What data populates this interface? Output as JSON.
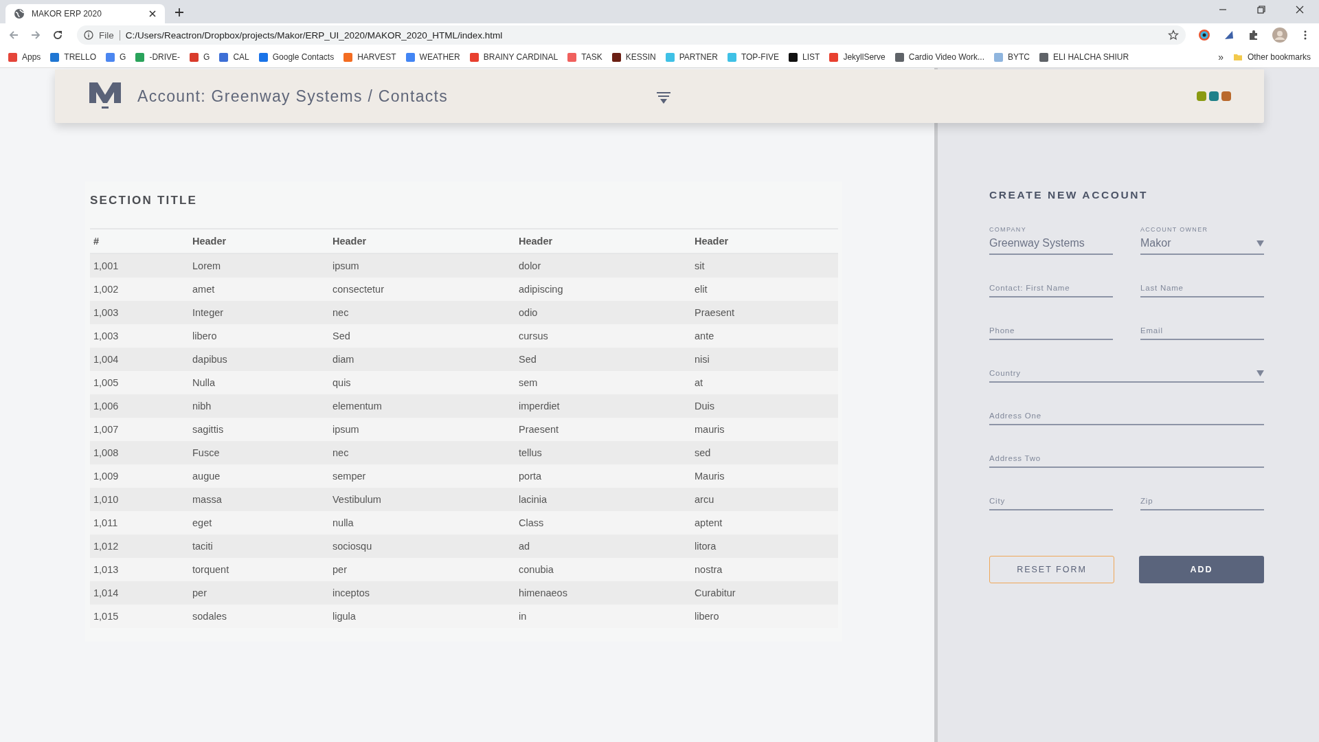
{
  "browser": {
    "tab": {
      "title": "MAKOR ERP 2020"
    },
    "address": {
      "scheme": "File",
      "url": "C:/Users/Reactron/Dropbox/projects/Makor/ERP_UI_2020/MAKOR_2020_HTML/index.html"
    },
    "bookmarks": [
      {
        "label": "Apps",
        "color": "#e5453a"
      },
      {
        "label": "TRELLO",
        "color": "#1f76d3"
      },
      {
        "label": "G",
        "color": "#4b86f0"
      },
      {
        "label": "-DRIVE-",
        "color": "#2aa35b"
      },
      {
        "label": "G",
        "color": "#d93b2b"
      },
      {
        "label": "CAL",
        "color": "#3d6fd6"
      },
      {
        "label": "Google Contacts",
        "color": "#1a73e8"
      },
      {
        "label": "HARVEST",
        "color": "#f36c21"
      },
      {
        "label": "WEATHER",
        "color": "#4285f4"
      },
      {
        "label": "BRAINY CARDINAL",
        "color": "#e8402f"
      },
      {
        "label": "TASK",
        "color": "#f0605d"
      },
      {
        "label": "KESSIN",
        "color": "#6b1f14"
      },
      {
        "label": "PARTNER",
        "color": "#3fc1e6"
      },
      {
        "label": "TOP-FIVE",
        "color": "#3fc1e6"
      },
      {
        "label": "LIST",
        "color": "#111111"
      },
      {
        "label": "JekyllServe",
        "color": "#e8402f"
      },
      {
        "label": "Cardio Video Work...",
        "color": "#5f6368"
      },
      {
        "label": "BYTC",
        "color": "#8fb5de"
      },
      {
        "label": "ELI HALCHA SHIUR",
        "color": "#5f6368"
      }
    ],
    "more": "»",
    "other_bookmarks": "Other bookmarks"
  },
  "header": {
    "title": "Account: Greenway Systems / Contacts",
    "dots": [
      {
        "color": "#8a9a12"
      },
      {
        "color": "#1f8089"
      },
      {
        "color": "#b9692c"
      }
    ]
  },
  "table": {
    "title": "SECTION TITLE",
    "columns": [
      "#",
      "Header",
      "Header",
      "Header",
      "Header"
    ],
    "rows": [
      [
        "1,001",
        "Lorem",
        "ipsum",
        "dolor",
        "sit"
      ],
      [
        "1,002",
        "amet",
        "consectetur",
        "adipiscing",
        "elit"
      ],
      [
        "1,003",
        "Integer",
        "nec",
        "odio",
        "Praesent"
      ],
      [
        "1,003",
        "libero",
        "Sed",
        "cursus",
        "ante"
      ],
      [
        "1,004",
        "dapibus",
        "diam",
        "Sed",
        "nisi"
      ],
      [
        "1,005",
        "Nulla",
        "quis",
        "sem",
        "at"
      ],
      [
        "1,006",
        "nibh",
        "elementum",
        "imperdiet",
        "Duis"
      ],
      [
        "1,007",
        "sagittis",
        "ipsum",
        "Praesent",
        "mauris"
      ],
      [
        "1,008",
        "Fusce",
        "nec",
        "tellus",
        "sed"
      ],
      [
        "1,009",
        "augue",
        "semper",
        "porta",
        "Mauris"
      ],
      [
        "1,010",
        "massa",
        "Vestibulum",
        "lacinia",
        "arcu"
      ],
      [
        "1,011",
        "eget",
        "nulla",
        "Class",
        "aptent"
      ],
      [
        "1,012",
        "taciti",
        "sociosqu",
        "ad",
        "litora"
      ],
      [
        "1,013",
        "torquent",
        "per",
        "conubia",
        "nostra"
      ],
      [
        "1,014",
        "per",
        "inceptos",
        "himenaeos",
        "Curabitur"
      ],
      [
        "1,015",
        "sodales",
        "ligula",
        "in",
        "libero"
      ]
    ]
  },
  "form": {
    "title": "CREATE NEW ACCOUNT",
    "rows": [
      [
        {
          "kind": "text",
          "label": "COMPANY",
          "value": "Greenway Systems"
        },
        {
          "kind": "select",
          "label": "ACCOUNT OWNER",
          "value": "Makor"
        }
      ],
      [
        {
          "kind": "text",
          "placeholder": "Contact: First Name"
        },
        {
          "kind": "text",
          "placeholder": "Last Name"
        }
      ],
      [
        {
          "kind": "text",
          "placeholder": "Phone"
        },
        {
          "kind": "text",
          "placeholder": "Email"
        }
      ],
      [
        {
          "kind": "select",
          "placeholder": "Country"
        }
      ],
      [
        {
          "kind": "text",
          "placeholder": "Address One"
        }
      ],
      [
        {
          "kind": "text",
          "placeholder": "Address Two"
        }
      ],
      [
        {
          "kind": "text",
          "placeholder": "City"
        },
        {
          "kind": "text",
          "placeholder": "Zip"
        }
      ]
    ],
    "buttons": [
      {
        "kind": "outline",
        "label": "RESET FORM"
      },
      {
        "kind": "primary",
        "label": "ADD"
      }
    ]
  }
}
